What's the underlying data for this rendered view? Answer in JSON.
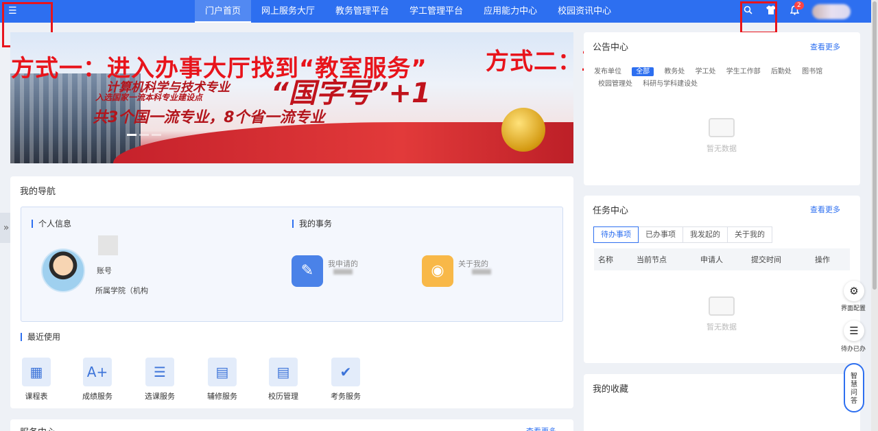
{
  "topbar": {
    "menu_icon": "☰",
    "nav": [
      "门户首页",
      "网上服务大厅",
      "教务管理平台",
      "学工管理平台",
      "应用能力中心",
      "校园资讯中心"
    ],
    "active_nav": "门户首页",
    "notification_count": "2"
  },
  "annotations": {
    "method1": "方式一：进入办事大厅找到“教室服务”",
    "method2": "方式二：直接搜索“教室服务”"
  },
  "banner": {
    "line1": "计算机科学与技术专业",
    "line2": "入选国家一流本科专业建设点",
    "big": "“国字号”+1",
    "line3": "共3个国一流专业，8个省一流专业"
  },
  "my_nav": {
    "title": "我的导航",
    "personal_info": "个人信息",
    "account_label": "账号",
    "college_label": "所属学院（机构",
    "my_affairs": "我的事务",
    "my_applications": "我申请的",
    "about_me": "关于我的",
    "recent_title": "最近使用",
    "apps": [
      "课程表",
      "成绩服务",
      "选课服务",
      "辅修服务",
      "校历管理",
      "考务服务"
    ]
  },
  "service_center": {
    "title": "服务中心",
    "more": "查看更多"
  },
  "notice_center": {
    "title": "公告中心",
    "more": "查看更多",
    "categories": [
      "发布单位",
      "全部",
      "教务处",
      "学工处",
      "学生工作部",
      "后勤处",
      "图书馆"
    ],
    "categories_row2": [
      "校园管理处",
      "科研与学科建设处"
    ],
    "empty": "暂无数据"
  },
  "task_center": {
    "title": "任务中心",
    "more": "查看更多",
    "tabs": [
      "待办事项",
      "已办事项",
      "我发起的",
      "关于我的"
    ],
    "columns": [
      "名称",
      "当前节点",
      "申请人",
      "提交时间",
      "操作"
    ],
    "empty": "暂无数据"
  },
  "favorites": {
    "title": "我的收藏"
  },
  "floating": {
    "settings_label": "界面配置",
    "todo_label": "待办已办",
    "ai_label": "智慧问答"
  }
}
